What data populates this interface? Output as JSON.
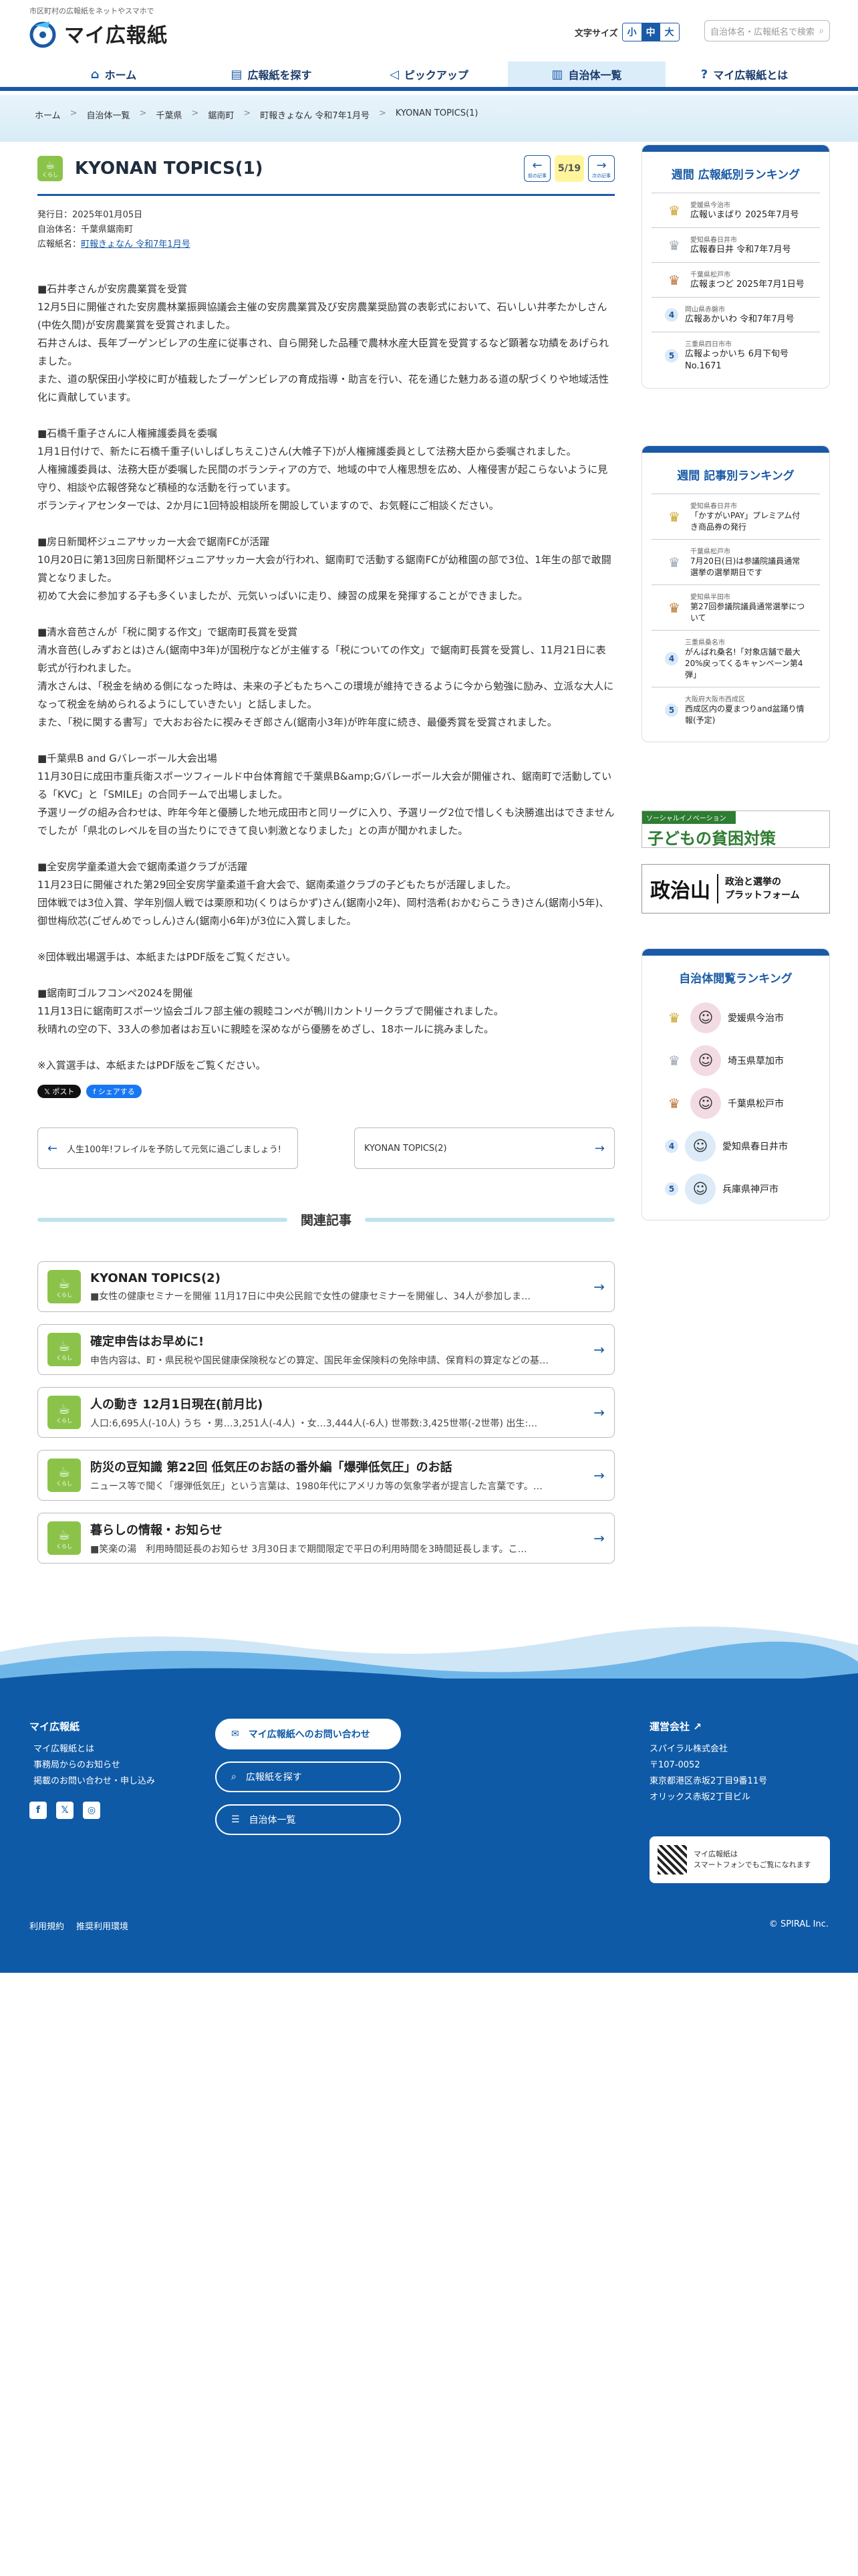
{
  "header": {
    "tagline": "市区町村の広報紙をネットやスマホで",
    "logo_text": "マイ広報紙",
    "fontsize_label": "文字サイズ",
    "fontsize_small": "小",
    "fontsize_medium": "中",
    "fontsize_large": "大",
    "search_placeholder": "自治体名・広報紙名で検索"
  },
  "nav": {
    "home": "ホーム",
    "find": "広報紙を探す",
    "pickup": "ピックアップ",
    "municipalities": "自治体一覧",
    "about": "マイ広報紙とは"
  },
  "breadcrumbs": [
    "ホーム",
    "自治体一覧",
    "千葉県",
    "鋸南町",
    "町報きょなん 令和7年1月号",
    "KYONAN TOPICS(1)"
  ],
  "article": {
    "category": "くらし",
    "title": "KYONAN TOPICS(1)",
    "prev_label": "前の記事",
    "next_label": "次の記事",
    "page": "5/19",
    "issued": "発行日：2025年01月05日",
    "municipality": "自治体名：千葉県鋸南町",
    "publication_prefix": "広報紙名：",
    "publication": "町報きょなん 令和7年1月号",
    "paragraphs": [
      "■石井孝さんが安房農業賞を受賞\n12月5日に開催された安房農林業振興協議会主催の安房農業賞及び安房農業奨励賞の表彰式において、石いしい井孝たかしさん(中佐久間)が安房農業賞を受賞されました。\n石井さんは、長年ブーゲンビレアの生産に従事され、自ら開発した品種で農林水産大臣賞を受賞するなど顕著な功績をあげられました。\nまた、道の駅保田小学校に町が植栽したブーゲンビレアの育成指導・助言を行い、花を通じた魅力ある道の駅づくりや地域活性化に貢献しています。",
      "■石橋千重子さんに人権擁護委員を委嘱\n1月1日付けで、新たに石橋千重子(いしばしちえこ)さん(大帷子下)が人権擁護委員として法務大臣から委嘱されました。\n人権擁護委員は、法務大臣が委嘱した民間のボランティアの方で、地域の中で人権思想を広め、人権侵害が起こらないように見守り、相談や広報啓発など積極的な活動を行っています。\nボランティアセンターでは、2か月に1回特設相談所を開設していますので、お気軽にご相談ください。",
      "■房日新聞杯ジュニアサッカー大会で鋸南FCが活躍\n10月20日に第13回房日新聞杯ジュニアサッカー大会が行われ、鋸南町で活動する鋸南FCが幼稚園の部で3位、1年生の部で敢闘賞となりました。\n初めて大会に参加する子も多くいましたが、元気いっぱいに走り、練習の成果を発揮することができました。",
      "■清水音芭さんが「税に関する作文」で鋸南町長賞を受賞\n清水音芭(しみずおとは)さん(鋸南中3年)が国税庁などが主催する「税についての作文」で鋸南町長賞を受賞し、11月21日に表彰式が行われました。\n清水さんは、「税金を納める側になった時は、未来の子どもたちへこの環境が維持できるように今から勉強に励み、立派な大人になって税金を納められるようにしていきたい」と話しました。\nまた、「税に関する書写」で大おお谷たに禊みそぎ郎さん(鋸南小3年)が昨年度に続き、最優秀賞を受賞されました。",
      "■千葉県B and Gバレーボール大会出場\n11月30日に成田市重兵衛スポーツフィールド中台体育館で千葉県B&amp;Gバレーボール大会が開催され、鋸南町で活動している「KVC」と「SMILE」の合同チームで出場しました。\n予選リーグの組み合わせは、昨年今年と優勝した地元成田市と同リーグに入り、予選リーグ2位で惜しくも決勝進出はできませんでしたが「県北のレベルを目の当たりにできて良い刺激となりました」との声が聞かれました。",
      "■全安房学童柔道大会で鋸南柔道クラブが活躍\n11月23日に開催された第29回全安房学童柔道千倉大会で、鋸南柔道クラブの子どもたちが活躍しました。\n団体戦では3位入賞、学年別個人戦では栗原和功(くりはらかず)さん(鋸南小2年)、岡村浩希(おかむらこうき)さん(鋸南小5年)、御世梅欣芯(ごぜんめでっしん)さん(鋸南小6年)が3位に入賞しました。",
      "※団体戦出場選手は、本紙またはPDF版をご覧ください。",
      "■鋸南町ゴルフコンペ2024を開催\n11月13日に鋸南町スポーツ協会ゴルフ部主催の親睦コンペが鴨川カントリークラブで開催されました。\n秋晴れの空の下、33人の参加者はお互いに親睦を深めながら優勝をめざし、18ホールに挑みました。",
      "※入賞選手は、本紙またはPDF版をご覧ください。"
    ],
    "share_x": "ポスト",
    "share_fb": "シェアする",
    "prev_article": "人生100年!フレイルを予防して元気に過ごしましょう!",
    "next_article": "KYONAN TOPICS(2)"
  },
  "related": {
    "heading": "関連記事",
    "items": [
      {
        "title": "KYONAN TOPICS(2)",
        "desc": "■女性の健康セミナーを開催 11月17日に中央公民館で女性の健康セミナーを開催し、34人が参加しま…"
      },
      {
        "title": "確定申告はお早めに!",
        "desc": "申告内容は、町・県民税や国民健康保険税などの算定、国民年金保険料の免除申請、保育料の算定などの基…"
      },
      {
        "title": "人の動き 12月1日現在(前月比)",
        "desc": "人口:6,695人(-10人) うち ・男…3,251人(-4人) ・女…3,444人(-6人) 世帯数:3,425世帯(-2世帯) 出生:…"
      },
      {
        "title": "防災の豆知識 第22回 低気圧のお話の番外編「爆弾低気圧」のお話",
        "desc": "ニュース等で聞く「爆弾低気圧」という言葉は、1980年代にアメリカ等の気象学者が提言した言葉です。…"
      },
      {
        "title": "暮らしの情報・お知らせ",
        "desc": "■笑楽の湯　利用時間延長のお知らせ 3月30日まで期間限定で平日の利用時間を3時間延長します。こ…"
      }
    ]
  },
  "sidebar": {
    "ranking1": {
      "title": "週間 広報紙別ランキング",
      "items": [
        {
          "rank": "1",
          "sub": "愛媛県今治市",
          "name": "広報いまばり 2025年7月号"
        },
        {
          "rank": "2",
          "sub": "愛知県春日井市",
          "name": "広報春日井 令和7年7月号"
        },
        {
          "rank": "3",
          "sub": "千葉県松戸市",
          "name": "広報まつど 2025年7月1日号"
        },
        {
          "rank": "4",
          "sub": "岡山県赤磐市",
          "name": "広報あかいわ 令和7年7月号"
        },
        {
          "rank": "5",
          "sub": "三重県四日市市",
          "name": "広報よっかいち 6月下旬号 No.1671"
        }
      ]
    },
    "ranking2": {
      "title": "週間 記事別ランキング",
      "items": [
        {
          "rank": "1",
          "sub": "愛知県春日井市",
          "name": "「かすがいPAY」プレミアム付き商品券の発行"
        },
        {
          "rank": "2",
          "sub": "千葉県松戸市",
          "name": "7月20日(日)は参議院議員通常選挙の選挙期日です"
        },
        {
          "rank": "3",
          "sub": "愛知県半田市",
          "name": "第27回参議院議員通常選挙について"
        },
        {
          "rank": "4",
          "sub": "三重県桑名市",
          "name": "がんばれ桑名!「対象店舗で最大20%戻ってくるキャンペーン第4弾」"
        },
        {
          "rank": "5",
          "sub": "大阪府大阪市西成区",
          "name": "西成区内の夏まつりand盆踊り情報(予定)"
        }
      ]
    },
    "banner1_top": "ソーシャルイノベーション",
    "banner1_text": "子どもの貧困対策",
    "banner2_logo": "政治山",
    "banner2_text": "政治と選挙の\nプラットフォーム",
    "ranking3": {
      "title": "自治体閲覧ランキング",
      "items": [
        {
          "rank": "1",
          "name": "愛媛県今治市"
        },
        {
          "rank": "2",
          "name": "埼玉県草加市"
        },
        {
          "rank": "3",
          "name": "千葉県松戸市"
        },
        {
          "rank": "4",
          "name": "愛知県春日井市"
        },
        {
          "rank": "5",
          "name": "兵庫県神戸市"
        }
      ]
    }
  },
  "footer": {
    "col1_title": "マイ広報紙",
    "col1_links": [
      "マイ広報紙とは",
      "事務局からのお知らせ",
      "掲載のお問い合わせ・申し込み"
    ],
    "btn_contact": "マイ広報紙へのお問い合わせ",
    "btn_find": "広報紙を探す",
    "btn_list": "自治体一覧",
    "company_title": "運営会社",
    "company_lines": [
      "スパイラル株式会社",
      "〒107-0052",
      "東京都港区赤坂2丁目9番11号",
      "オリックス赤坂2丁目ビル"
    ],
    "qr_text": "マイ広報紙は\nスマートフォンでもご覧になれます",
    "terms": "利用規約",
    "env": "推奨利用環境",
    "copyright": "© SPIRAL Inc."
  },
  "colors": {
    "primary": "#1a5aa6",
    "footer": "#0e5aa7",
    "category": "#8bc34a",
    "page_badge": "#fff59d"
  }
}
